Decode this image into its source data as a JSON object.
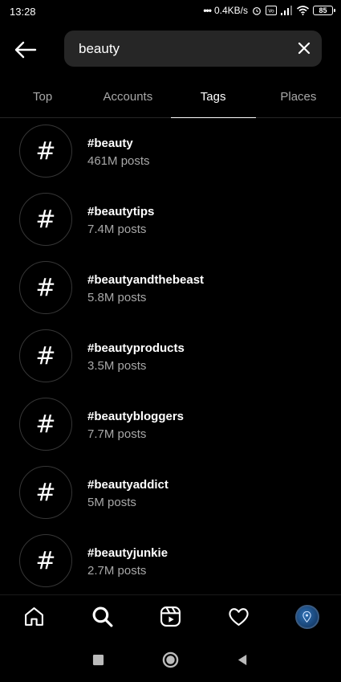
{
  "status_bar": {
    "time": "13:28",
    "net_speed": "0.4KB/s",
    "battery": "85"
  },
  "search": {
    "value": "beauty",
    "placeholder": "Search"
  },
  "tabs": [
    {
      "label": "Top",
      "active": false
    },
    {
      "label": "Accounts",
      "active": false
    },
    {
      "label": "Tags",
      "active": true
    },
    {
      "label": "Places",
      "active": false
    }
  ],
  "tags": [
    {
      "symbol": "#",
      "name": "#beauty",
      "count": "461M posts"
    },
    {
      "symbol": "#",
      "name": "#beautytips",
      "count": "7.4M posts"
    },
    {
      "symbol": "#",
      "name": "#beautyandthebeast",
      "count": "5.8M posts"
    },
    {
      "symbol": "#",
      "name": "#beautyproducts",
      "count": "3.5M posts"
    },
    {
      "symbol": "#",
      "name": "#beautybloggers",
      "count": "7.7M posts"
    },
    {
      "symbol": "#",
      "name": "#beautyaddict",
      "count": "5M posts"
    },
    {
      "symbol": "#",
      "name": "#beautyjunkie",
      "count": "2.7M posts"
    }
  ],
  "bottom_nav": [
    {
      "icon": "home-icon"
    },
    {
      "icon": "search-icon",
      "active": true
    },
    {
      "icon": "reels-icon"
    },
    {
      "icon": "heart-icon"
    },
    {
      "icon": "profile-avatar"
    }
  ],
  "system_nav": [
    {
      "icon": "recents-square-icon"
    },
    {
      "icon": "home-circle-icon"
    },
    {
      "icon": "back-triangle-icon"
    }
  ]
}
